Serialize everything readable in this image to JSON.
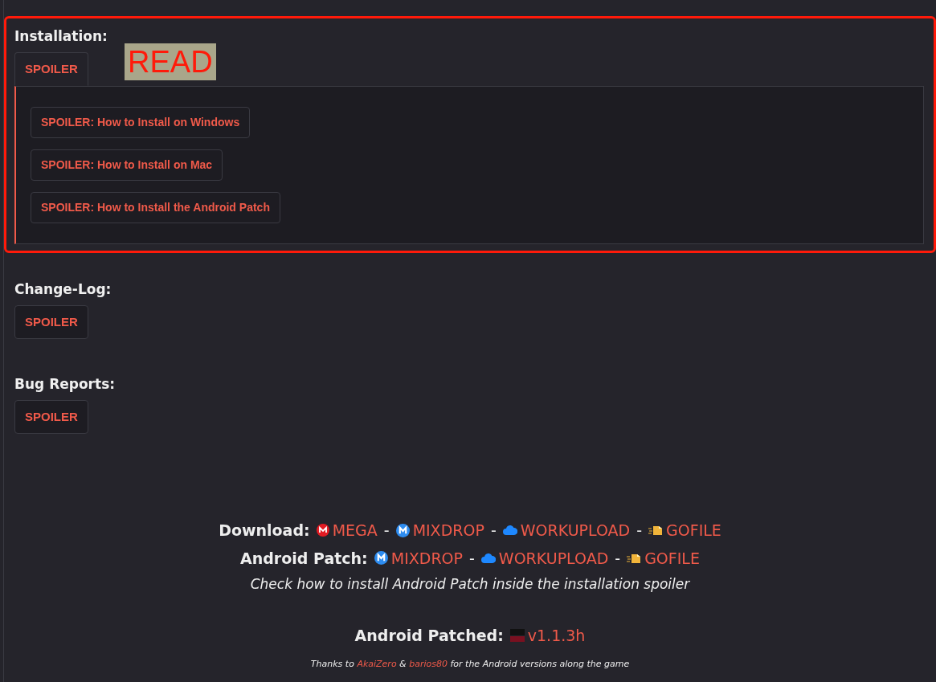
{
  "sections": [
    {
      "heading": "Installation:",
      "highlighted": true,
      "note": "READ",
      "spoiler": {
        "label": "SPOILER",
        "expanded": true,
        "children": [
          {
            "label": "SPOILER: How to Install on Windows",
            "expanded": false
          },
          {
            "label": "SPOILER: How to Install on Mac",
            "expanded": false
          },
          {
            "label": "SPOILER: How to Install the Android Patch",
            "expanded": false
          }
        ]
      }
    },
    {
      "heading": "Change-Log:",
      "highlighted": false,
      "spoiler": {
        "label": "SPOILER",
        "expanded": false
      }
    },
    {
      "heading": "Bug Reports:",
      "highlighted": false,
      "spoiler": {
        "label": "SPOILER",
        "expanded": false
      }
    }
  ],
  "downloads": [
    {
      "label": "Download:",
      "links": [
        {
          "kind": "mega",
          "text": "MEGA"
        },
        {
          "kind": "mixdrop",
          "text": "MIXDROP"
        },
        {
          "kind": "cloud",
          "text": "WORKUPLOAD"
        },
        {
          "kind": "gofile",
          "text": "GOFILE"
        }
      ]
    },
    {
      "label": "Android Patch:",
      "links": [
        {
          "kind": "mixdrop",
          "text": "MIXDROP"
        },
        {
          "kind": "cloud",
          "text": "WORKUPLOAD"
        },
        {
          "kind": "gofile",
          "text": "GOFILE"
        }
      ]
    }
  ],
  "separator": "-",
  "hint": "Check how to install Android Patch inside the installation spoiler",
  "patched": {
    "label": "Android Patched:",
    "version": "v1.1.3h"
  },
  "thanks": [
    {
      "text": "Thanks to ",
      "link": false
    },
    {
      "text": "AkaiZero",
      "link": true
    },
    {
      "text": " & ",
      "link": false
    },
    {
      "text": "barios80",
      "link": true
    },
    {
      "text": " for the Android versions along the game",
      "link": false
    }
  ]
}
